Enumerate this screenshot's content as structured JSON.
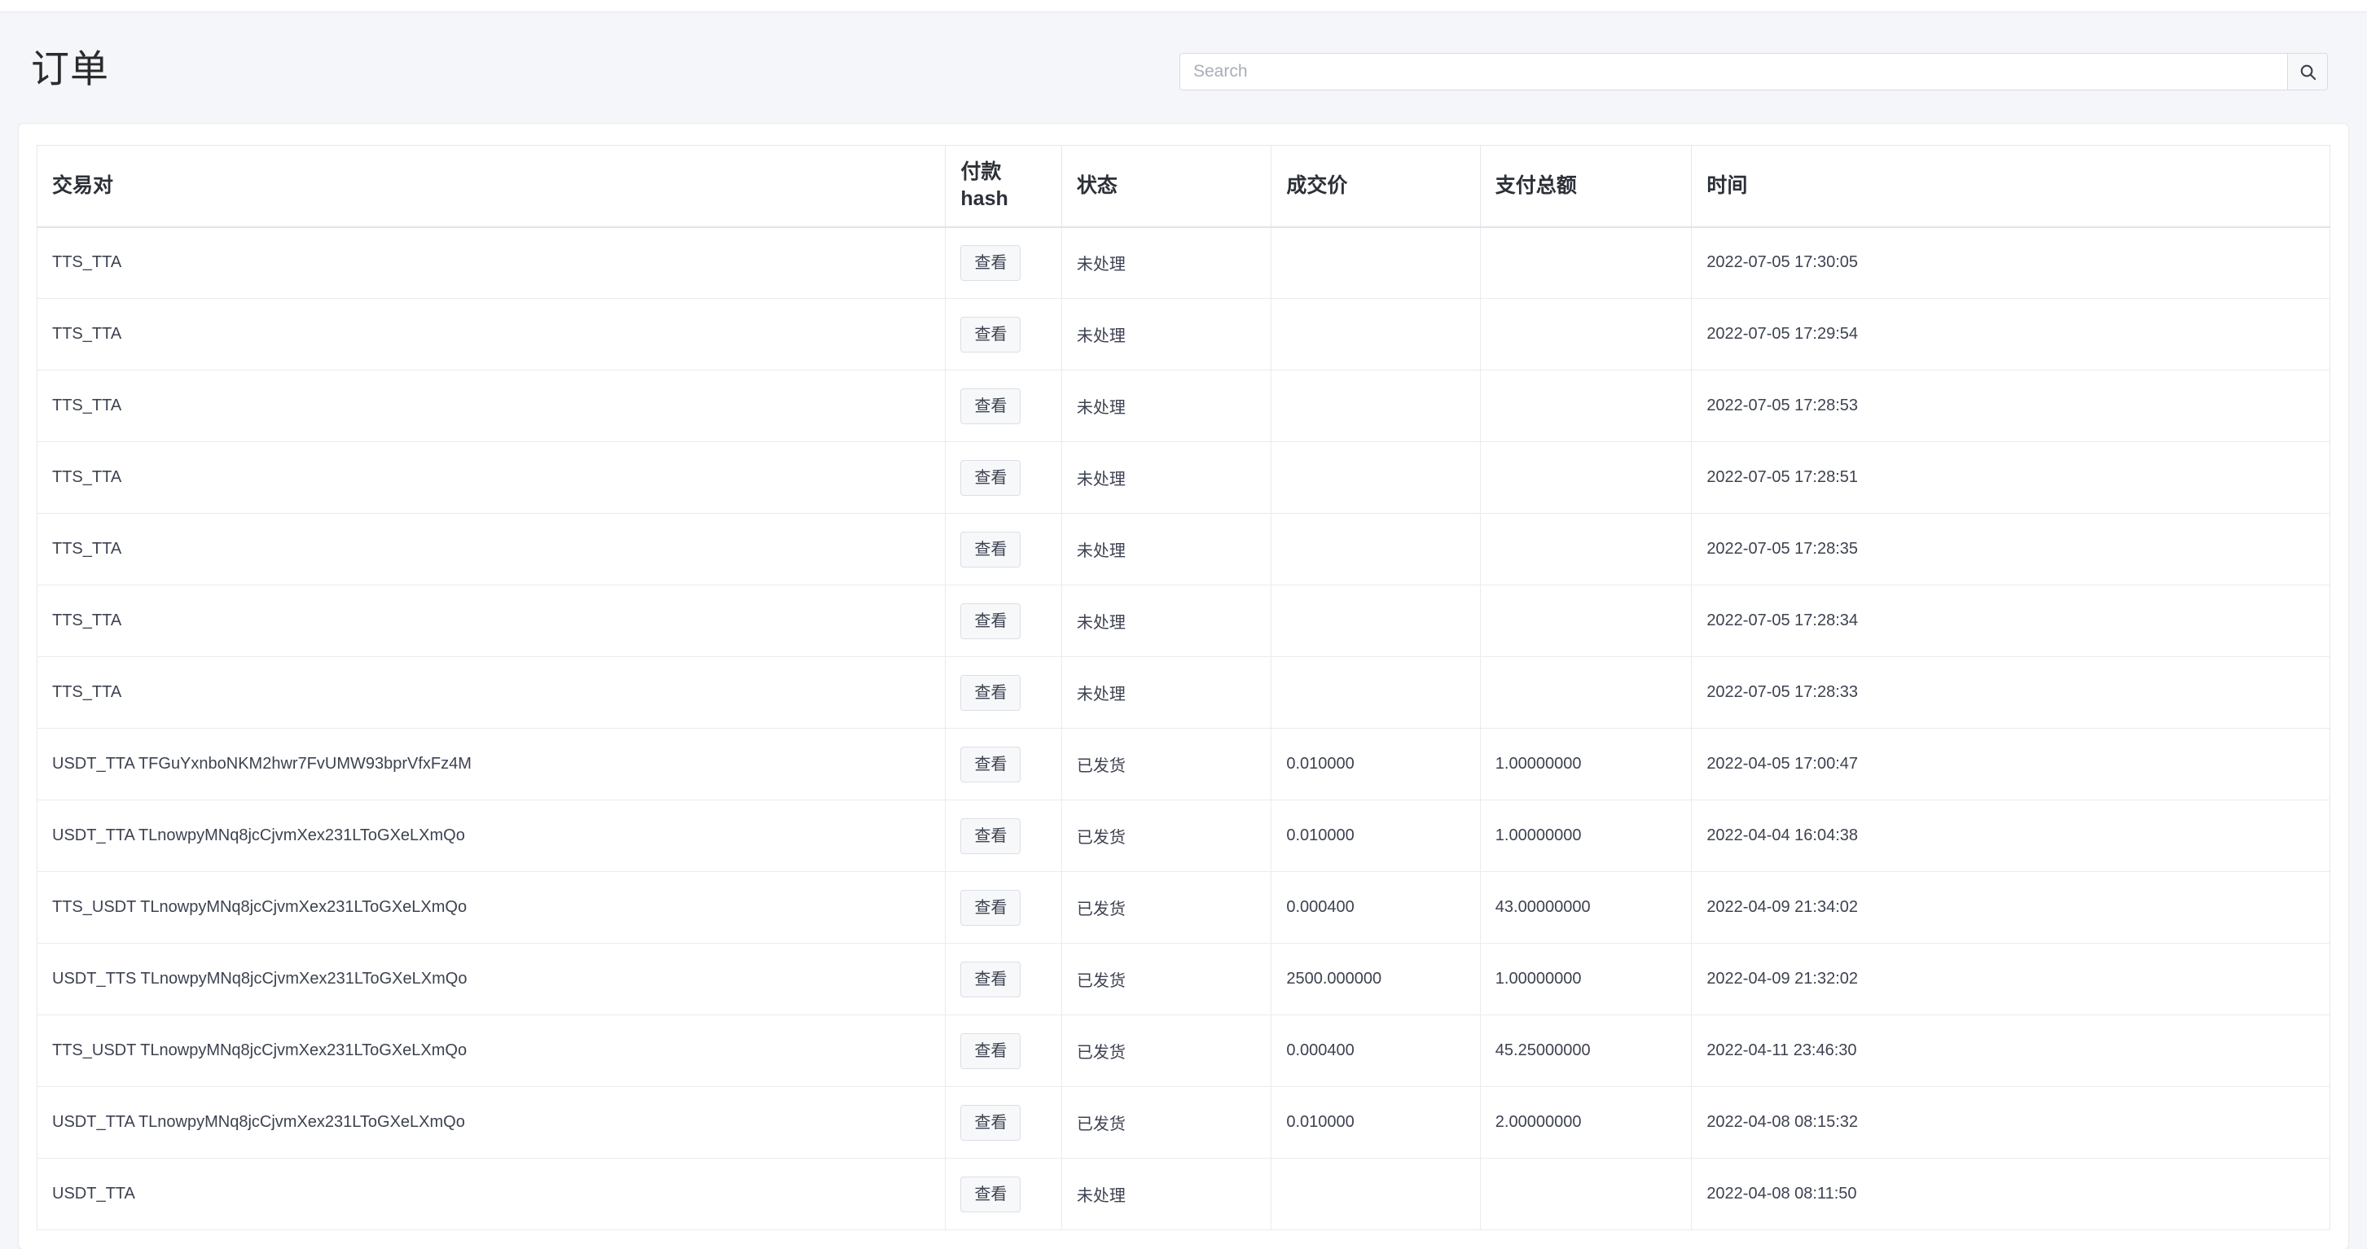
{
  "page": {
    "title": "订单"
  },
  "search": {
    "placeholder": "Search",
    "value": "",
    "button_icon": "search-icon"
  },
  "table": {
    "columns": [
      {
        "key": "pair",
        "label": "交易对"
      },
      {
        "key": "hash",
        "label": "付款\nhash"
      },
      {
        "key": "status",
        "label": "状态"
      },
      {
        "key": "price",
        "label": "成交价"
      },
      {
        "key": "total",
        "label": "支付总额"
      },
      {
        "key": "time",
        "label": "时间"
      }
    ],
    "hash_header_line1": "付款",
    "hash_header_line2": "hash",
    "view_button_label": "查看",
    "rows": [
      {
        "pair": "TTS_TTA",
        "hash": "查看",
        "status": "未处理",
        "price": "",
        "total": "",
        "time": "2022-07-05 17:30:05"
      },
      {
        "pair": "TTS_TTA",
        "hash": "查看",
        "status": "未处理",
        "price": "",
        "total": "",
        "time": "2022-07-05 17:29:54"
      },
      {
        "pair": "TTS_TTA",
        "hash": "查看",
        "status": "未处理",
        "price": "",
        "total": "",
        "time": "2022-07-05 17:28:53"
      },
      {
        "pair": "TTS_TTA",
        "hash": "查看",
        "status": "未处理",
        "price": "",
        "total": "",
        "time": "2022-07-05 17:28:51"
      },
      {
        "pair": "TTS_TTA",
        "hash": "查看",
        "status": "未处理",
        "price": "",
        "total": "",
        "time": "2022-07-05 17:28:35"
      },
      {
        "pair": "TTS_TTA",
        "hash": "查看",
        "status": "未处理",
        "price": "",
        "total": "",
        "time": "2022-07-05 17:28:34"
      },
      {
        "pair": "TTS_TTA",
        "hash": "查看",
        "status": "未处理",
        "price": "",
        "total": "",
        "time": "2022-07-05 17:28:33"
      },
      {
        "pair": "USDT_TTA TFGuYxnboNKM2hwr7FvUMW93bprVfxFz4M",
        "hash": "查看",
        "status": "已发货",
        "price": "0.010000",
        "total": "1.00000000",
        "time": "2022-04-05 17:00:47"
      },
      {
        "pair": "USDT_TTA TLnowpyMNq8jcCjvmXex231LToGXeLXmQo",
        "hash": "查看",
        "status": "已发货",
        "price": "0.010000",
        "total": "1.00000000",
        "time": "2022-04-04 16:04:38"
      },
      {
        "pair": "TTS_USDT TLnowpyMNq8jcCjvmXex231LToGXeLXmQo",
        "hash": "查看",
        "status": "已发货",
        "price": "0.000400",
        "total": "43.00000000",
        "time": "2022-04-09 21:34:02"
      },
      {
        "pair": "USDT_TTS TLnowpyMNq8jcCjvmXex231LToGXeLXmQo",
        "hash": "查看",
        "status": "已发货",
        "price": "2500.000000",
        "total": "1.00000000",
        "time": "2022-04-09 21:32:02"
      },
      {
        "pair": "TTS_USDT TLnowpyMNq8jcCjvmXex231LToGXeLXmQo",
        "hash": "查看",
        "status": "已发货",
        "price": "0.000400",
        "total": "45.25000000",
        "time": "2022-04-11 23:46:30"
      },
      {
        "pair": "USDT_TTA TLnowpyMNq8jcCjvmXex231LToGXeLXmQo",
        "hash": "查看",
        "status": "已发货",
        "price": "0.010000",
        "total": "2.00000000",
        "time": "2022-04-08 08:15:32"
      },
      {
        "pair": "USDT_TTA",
        "hash": "查看",
        "status": "未处理",
        "price": "",
        "total": "",
        "time": "2022-04-08 08:11:50"
      }
    ]
  },
  "colors": {
    "page_background": "#f4f6f9",
    "card_background": "#ffffff",
    "border": "#e4e7ec",
    "text": "#3d4250",
    "title": "#2b2b2b"
  }
}
